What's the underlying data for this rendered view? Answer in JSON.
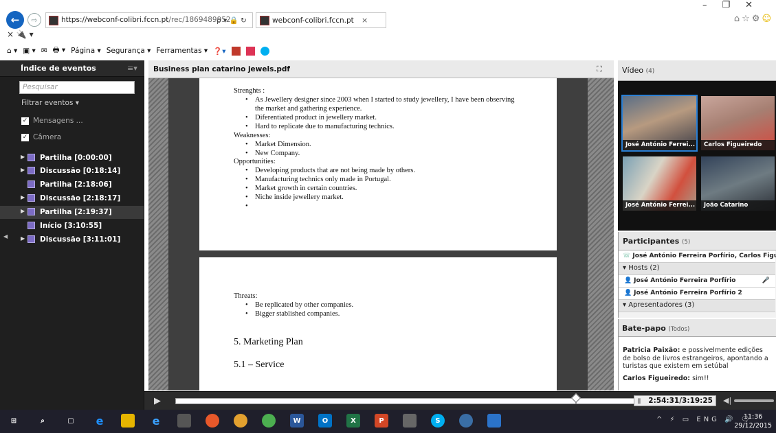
{
  "browser": {
    "url_host": "https://webconf-colibri.fccn.pt",
    "url_path": "/rec/1869489952",
    "addr_controls": "ρ ▾ 🔒 ↻",
    "tab_title": "webconf-colibri.fccn.pt",
    "tab_close": "×",
    "row2": "×  🔌 ▾",
    "commands": [
      "Página ▾",
      "Segurança ▾",
      "Ferramentas ▾"
    ]
  },
  "events": {
    "title": "Índice de eventos",
    "menu": "≡▾",
    "search_placeholder": "Pesquisar",
    "filter_label": "Filtrar eventos ▾",
    "checks": [
      {
        "label": "Mensagens ..."
      },
      {
        "label": "Câmera"
      }
    ],
    "items": [
      {
        "arrow": "▶",
        "label": "Partilha [0:00:00]"
      },
      {
        "arrow": "▶",
        "label": "Discussão [0:18:14]"
      },
      {
        "arrow": "",
        "label": "Partilha [2:18:06]"
      },
      {
        "arrow": "▶",
        "label": "Discussão [2:18:17]"
      },
      {
        "arrow": "▶",
        "label": "Partilha [2:19:37]"
      },
      {
        "arrow": "",
        "label": "Início [3:10:55]"
      },
      {
        "arrow": "▶",
        "label": "Discussão [3:11:01]"
      }
    ]
  },
  "document": {
    "title": "Business plan catarino jewels.pdf",
    "page1": {
      "strengths_label": "Strenghts :",
      "strengths": [
        "As Jewellery designer since 2003 when I started to study jewellery, I have been observing",
        "the market and gathering experience.",
        "Diferentiated product in jewellery market.",
        "Hard to replicate due to manufacturing technics."
      ],
      "weaknesses_label": "Weaknesses:",
      "weaknesses": [
        "Market Dimension.",
        "New Company."
      ],
      "opportunities_label": "Opportunities:",
      "opportunities": [
        "Developing products that are not being made by others.",
        "Manufacturing technics only made in Portugal.",
        "Market growth in certain countries.",
        "Niche inside jewellery market.",
        ""
      ]
    },
    "page2": {
      "threats_label": "Threats:",
      "threats": [
        "Be replicated by other companies.",
        "Bigger stablished companies."
      ],
      "heading1": "5. Marketing Plan",
      "heading2": "5.1 – Service"
    }
  },
  "video": {
    "title": "Vídeo",
    "count": "(4)",
    "tiles": [
      {
        "name": "José António Ferrei..."
      },
      {
        "name": "Carlos Figueiredo"
      },
      {
        "name": "José António Ferrei..."
      },
      {
        "name": "João Catarino"
      }
    ]
  },
  "participants": {
    "title": "Participantes",
    "count": "(5)",
    "phone_row": "José António Ferreira Porfírio, Carlos Figueiredo",
    "hosts_label": "Hosts (2)",
    "hosts": [
      "José António Ferreira Porfírio",
      "José António Ferreira Porfírio 2"
    ],
    "presenters_label": "Apresentadores (3)"
  },
  "chat": {
    "title": "Bate-papo",
    "scope": "(Todos)",
    "messages": [
      {
        "author": "Patricia Paixão:",
        "text": " e possivelmente edições de bolso de livros estrangeiros, apontando a turistas que existem em setúbal"
      },
      {
        "author": "Carlos Figueiredo:",
        "text": " sim!!"
      }
    ]
  },
  "playback": {
    "play": "▶",
    "time": "2:54:31/3:19:25",
    "progress_fraction": 0.875
  },
  "taskbar": {
    "clock_time": "11:36",
    "clock_date": "29/12/2015",
    "tray": "^ ⚡ ▭ ENG 🔊 🗨"
  },
  "colors": {
    "event_icon": "#7c6cc4",
    "accent": "#1565c0"
  }
}
